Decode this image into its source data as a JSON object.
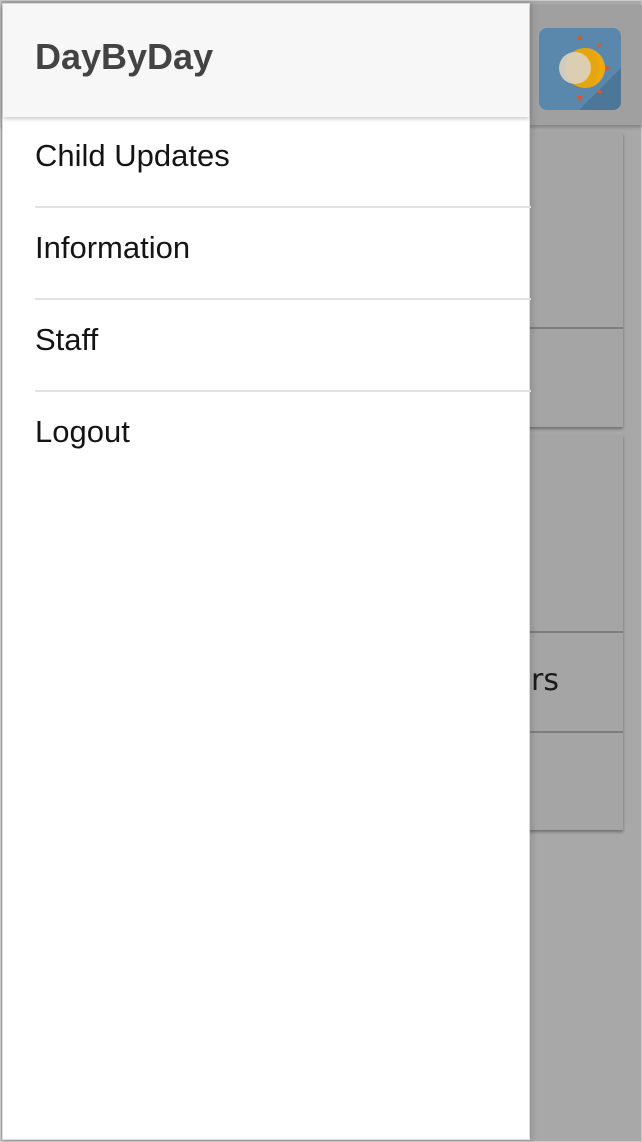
{
  "app": {
    "name": "DayByDay"
  },
  "drawer": {
    "title": "DayByDay",
    "items": [
      {
        "label": "Child Updates"
      },
      {
        "label": "Information"
      },
      {
        "label": "Staff"
      },
      {
        "label": "Logout"
      }
    ]
  },
  "background": {
    "partial_card_text": "rs"
  },
  "colors": {
    "logo_bg": "#5a88ad",
    "sun": "#f2a900",
    "scrim": "#a6a6a6"
  }
}
